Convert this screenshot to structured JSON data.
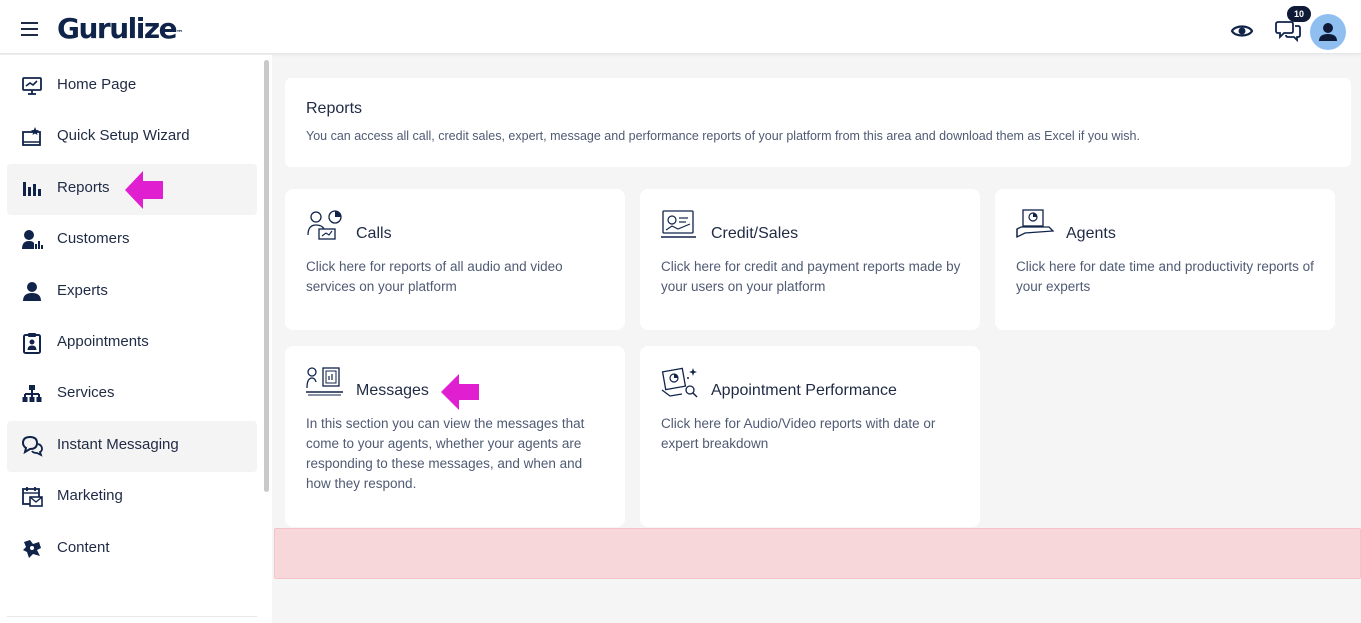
{
  "header": {
    "logo_text": "Gurulize",
    "logo_mark": "™",
    "notification_count": "10"
  },
  "sidebar": {
    "items": [
      {
        "label": "Home Page",
        "icon": "monitor-chart-icon"
      },
      {
        "label": "Quick Setup Wizard",
        "icon": "setup-wizard-icon"
      },
      {
        "label": "Reports",
        "icon": "bar-chart-icon"
      },
      {
        "label": "Customers",
        "icon": "customers-icon"
      },
      {
        "label": "Experts",
        "icon": "user-icon"
      },
      {
        "label": "Appointments",
        "icon": "clipboard-user-icon"
      },
      {
        "label": "Services",
        "icon": "hierarchy-icon"
      },
      {
        "label": "Instant Messaging",
        "icon": "chat-bubbles-icon"
      },
      {
        "label": "Marketing",
        "icon": "calendar-mail-icon"
      },
      {
        "label": "Content",
        "icon": "puzzle-icon"
      }
    ]
  },
  "main": {
    "title": "Reports",
    "description": "You can access all call, credit sales, expert, message and performance reports of your platform from this area and download them as Excel if you wish.",
    "cards": [
      {
        "title": "Calls",
        "description": "Click here for reports of all audio and video services on your platform",
        "icon": "calls-report-icon"
      },
      {
        "title": "Credit/Sales",
        "description": "Click here for credit and payment reports made by your users on your platform",
        "icon": "credit-sales-icon"
      },
      {
        "title": "Agents",
        "description": "Click here for date time and productivity reports of your experts",
        "icon": "agents-report-icon"
      },
      {
        "title": "Messages",
        "description": "In this section you can view the messages that come to your agents, whether your agents are responding to these messages, and when and how they respond.",
        "icon": "messages-report-icon"
      },
      {
        "title": "Appointment Performance",
        "description": "Click here for Audio/Video reports with date or expert breakdown",
        "icon": "appointment-performance-icon"
      }
    ]
  },
  "colors": {
    "brand": "#10244a",
    "highlight_arrow": "#e020d0",
    "alert_background": "#f8d7da",
    "avatar": "#8fbff0"
  }
}
